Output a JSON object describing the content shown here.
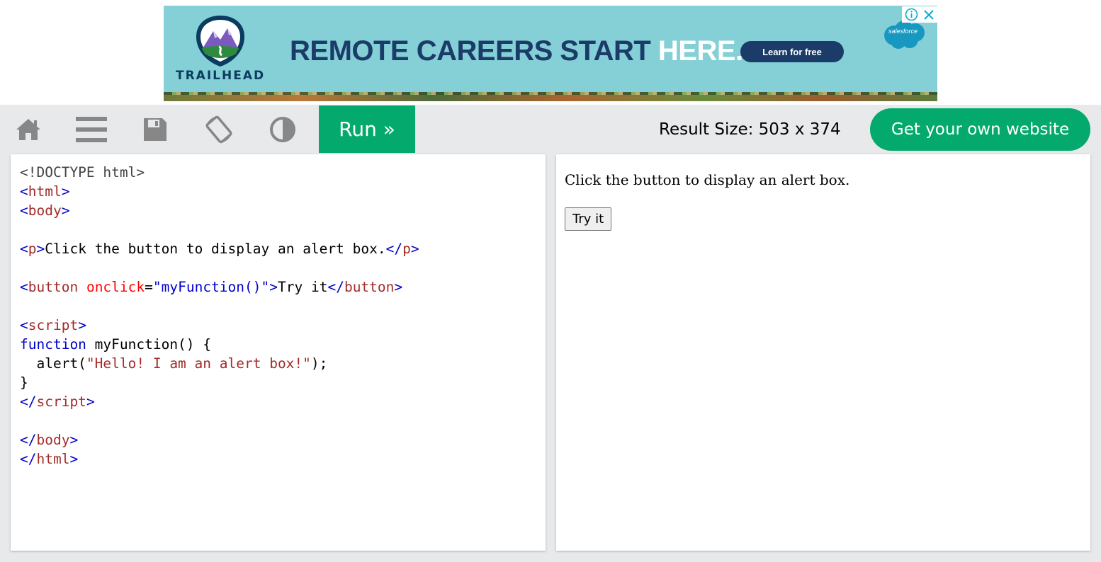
{
  "ad": {
    "brand": "TRAILHEAD",
    "headline_main": "REMOTE CAREERS START ",
    "headline_accent": "HERE.",
    "cta_label": "Learn for free",
    "sponsor": "salesforce",
    "colors": {
      "background": "#84d0d6",
      "text": "#1b3b68",
      "cta": "#1b3b68"
    }
  },
  "toolbar": {
    "icons": [
      "home-icon",
      "menu-icon",
      "save-icon",
      "rotate-icon",
      "contrast-icon"
    ],
    "run_label": "Run »",
    "result_size": "Result Size: 503 x 374",
    "get_site_label": "Get your own website",
    "colors": {
      "accent": "#04aa6d",
      "background": "#e7e9eb"
    }
  },
  "editor": {
    "code": {
      "doctype": "<!DOCTYPE html>",
      "html_open": "html",
      "body_open": "body",
      "p_text": "Click the button to display an alert box.",
      "button_attr": "onclick",
      "button_val": "\"myFunction()\"",
      "button_text": "Try it",
      "script_tag": "script",
      "fn_keyword": "function",
      "fn_sig": " myFunction() {",
      "alert_call": "  alert(",
      "alert_str": "\"Hello! I am an alert box!\"",
      "alert_end": ");",
      "close_brace": "}",
      "body_close": "body",
      "html_close": "html"
    }
  },
  "result": {
    "paragraph": "Click the button to display an alert box.",
    "button_label": "Try it"
  }
}
